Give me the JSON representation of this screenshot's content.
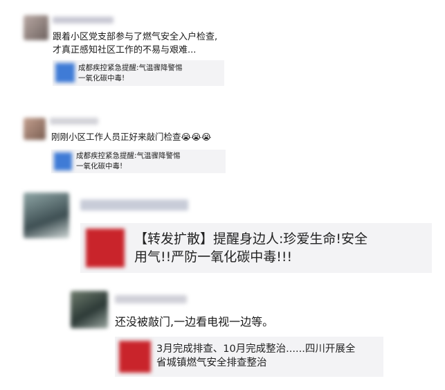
{
  "posts": [
    {
      "text": "跟着小区党支部参与了燃气安全入户检查,\n才真正感知社区工作的不易与艰难...",
      "share": {
        "title": "成都疾控紧急提醒:气温骤降警惕\n一氧化碳中毒!"
      }
    },
    {
      "text": "刚刚小区工作人员正好来敲门检查😭😭😭",
      "share": {
        "title": "成都疾控紧急提醒:气温骤降警惕\n一氧化碳中毒!"
      }
    },
    {
      "share": {
        "title": "【转发扩散】提醒身边人:珍爱生命!安全\n用气!!严防一氧化碳中毒!!!"
      }
    },
    {
      "text": "还没被敲门,一边看电视一边等。",
      "share": {
        "title": "3月完成排查、10月完成整治......四川开展全\n省城镇燃气安全排查整治"
      }
    }
  ],
  "colors": {
    "share_bg": "#f3f3f5",
    "share_thumb_blue": "#3f7bd6",
    "share_thumb_red": "#c9242b"
  }
}
